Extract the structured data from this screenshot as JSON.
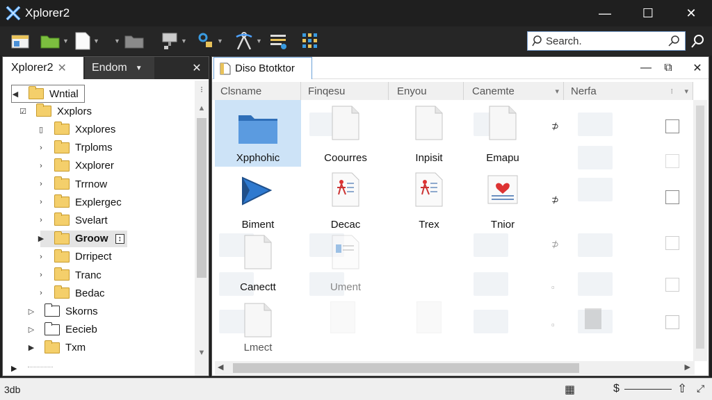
{
  "window": {
    "title": "Xplorer2",
    "min_glyph": "—",
    "max_glyph": "☐",
    "close_glyph": "✕"
  },
  "toolbar": {
    "icons": [
      "pane-icon",
      "green-folder-icon",
      "new-file-icon",
      "folder-icon",
      "network-icon",
      "search-network-icon",
      "compass-icon",
      "list-icon",
      "grid-icon"
    ]
  },
  "search": {
    "placeholder": "Search."
  },
  "left_panel": {
    "tabs": [
      {
        "label": "Xplorer2",
        "close": "✕"
      },
      {
        "label": "Endom",
        "caret": "▼"
      }
    ],
    "close_glyph": "✕",
    "menu_glyph": "⁝",
    "tree": [
      {
        "label": "Wntial",
        "expander": "◀",
        "folder": "yellow",
        "selected_box": true
      },
      {
        "label": "Xxplors",
        "expander": "☑",
        "folder": "yellow"
      },
      {
        "label": "Xxplores",
        "expander": "▯",
        "folder": "yellow"
      },
      {
        "label": "Trploms",
        "expander": "›",
        "folder": "yellow"
      },
      {
        "label": "Xxplorer",
        "expander": "›",
        "folder": "yellow"
      },
      {
        "label": "Trrnow",
        "expander": "›",
        "folder": "yellow"
      },
      {
        "label": "Explergec",
        "expander": "›",
        "folder": "yellow"
      },
      {
        "label": "Svelart",
        "expander": "›",
        "folder": "yellow"
      },
      {
        "label": "Groow",
        "expander": "▶",
        "folder": "yellow",
        "bold": true,
        "badge": "↕"
      },
      {
        "label": "Drripect",
        "expander": "›",
        "folder": "yellow"
      },
      {
        "label": "Tranc",
        "expander": "›",
        "folder": "yellow"
      },
      {
        "label": "Bedac",
        "expander": "›",
        "folder": "yellow"
      },
      {
        "label": "Skorns",
        "expander": "▷",
        "folder": "white"
      },
      {
        "label": "Eecieb",
        "expander": "▷",
        "folder": "white"
      },
      {
        "label": "Txm",
        "expander": "▶",
        "folder": "yellow"
      }
    ]
  },
  "right_panel": {
    "tab_label": "Diso Btotktor",
    "columns": [
      "Clsname",
      "Finqesu",
      "Enyou",
      "Canemte",
      "Nerfa"
    ],
    "column_sort_glyph": "▾",
    "items": [
      {
        "label": "Xpphohic",
        "icon": "folder-blue",
        "selected": true
      },
      {
        "label": "Coourres",
        "icon": "document"
      },
      {
        "label": "Inpisit",
        "icon": "document"
      },
      {
        "label": "Emapu",
        "icon": "document"
      },
      {
        "label": "Biment",
        "icon": "blue-arrow"
      },
      {
        "label": "Decac",
        "icon": "doc-figure"
      },
      {
        "label": "Trex",
        "icon": "doc-figure"
      },
      {
        "label": "Tnior",
        "icon": "doc-heart"
      },
      {
        "label": "Canectt",
        "icon": "document"
      },
      {
        "label": "Ument",
        "icon": "doc-faded"
      },
      {
        "label": "Lmect",
        "icon": "document"
      }
    ],
    "side_glyph": "⊅"
  },
  "status_bar": {
    "left_text": "3db",
    "currency_glyph": "$",
    "calc_glyph": "▦",
    "up_glyph": "⇧",
    "expand_glyph": "⤢"
  }
}
